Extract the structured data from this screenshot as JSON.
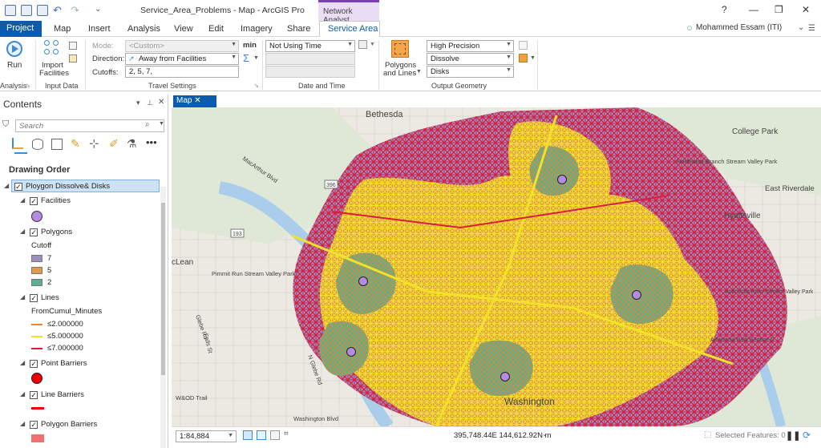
{
  "title_bar": {
    "title": "Service_Area_Problems - Map - ArcGIS Pro",
    "contextual_tab": "Network Analyst",
    "help": "?",
    "minimize": "—",
    "restore": "❐",
    "close": "✕"
  },
  "tabs": {
    "project": "Project",
    "items": [
      "Map",
      "Insert",
      "Analysis",
      "View",
      "Edit",
      "Imagery",
      "Share"
    ],
    "active": "Service Area"
  },
  "user": {
    "name": "Mohammed Essam (ITI)"
  },
  "ribbon": {
    "run_label": "Run",
    "analysis_group": "Analysis",
    "import_label": "Import",
    "import_label2": "Facilities",
    "input_data_group": "Input Data",
    "mode_label": "Mode:",
    "mode_value": "<Custom>",
    "min_label": "min",
    "direction_label": "Direction:",
    "direction_value": "Away from Facilities",
    "cutoffs_label": "Cutoffs:",
    "cutoffs_value": "2, 5, 7,",
    "travel_group": "Travel Settings",
    "time_value": "Not Using Time",
    "date_group": "Date and Time",
    "polygons_label": "Polygons",
    "polygons_label2": "and Lines",
    "precision_value": "High Precision",
    "dissolve_value": "Dissolve",
    "disks_value": "Disks",
    "output_group": "Output Geometry"
  },
  "contents": {
    "title": "Contents",
    "search_placeholder": "Search",
    "drawing_order": "Drawing Order",
    "layer_name": "Ploygon  Dissolve& Disks",
    "facilities": "Facilities",
    "polygons": "Polygons",
    "cutoff": "Cutoff",
    "polygon_classes": [
      "7",
      "5",
      "2"
    ],
    "lines": "Lines",
    "lines_field": "FromCumul_Minutes",
    "line_classes": [
      "≤2.000000",
      "≤5.000000",
      "≤7.000000"
    ],
    "point_barriers": "Point Barriers",
    "line_barriers": "Line Barriers",
    "polygon_barriers": "Polygon Barriers"
  },
  "colors": {
    "poly7": "#9b8fc4",
    "poly5": "#e39a48",
    "poly2": "#5bb08e",
    "line2": "#e8862b",
    "line5": "#f2e22a",
    "line7": "#d81e3c",
    "facility": "#b48be0",
    "accent": "#0b5cad"
  },
  "map": {
    "tab_label": "Map",
    "place_labels": [
      "Bethesda",
      "College Park",
      "East Riverdale",
      "Hyattsville",
      "cLean",
      "Washington"
    ],
    "park_labels": [
      "Northwest Branch Stream Valley Park",
      "Pimmit Run Stream Valley Park",
      "Anacostia River Stream Valley Park",
      "Anacostia Park Section G"
    ],
    "road_labels": [
      "MacArthur Blvd",
      "Glebe Rd",
      "W&OD Trail",
      "Washington Blvd",
      "N Glebe Rd",
      "Falls St"
    ],
    "shields": [
      "396",
      "193"
    ]
  },
  "status": {
    "scale": "1:84,884",
    "coords": "395,748.44E 144,612.92N m",
    "selected": "Selected Features: 0"
  }
}
